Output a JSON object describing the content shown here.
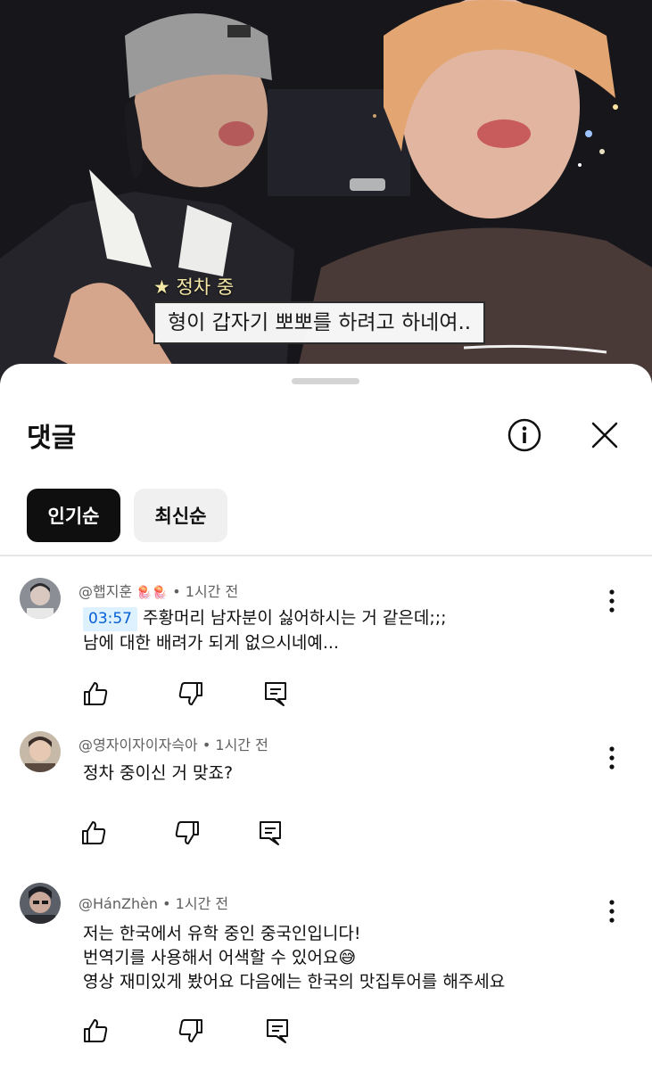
{
  "video": {
    "caption_label": "★ 정차 중",
    "caption_text": "형이 갑자기 뽀뽀를 하려고 하네여.."
  },
  "sheet": {
    "title": "댓글",
    "info_icon": "info-circle-icon",
    "close_icon": "close-icon",
    "sort_chips": [
      {
        "label": "인기순",
        "selected": true
      },
      {
        "label": "최신순",
        "selected": false
      }
    ]
  },
  "comments": [
    {
      "author": "@햅지훈",
      "author_emoji": "🪼🪼",
      "time": "• 1시간 전",
      "timestamp_link": "03:57",
      "lines": [
        "주황머리 남자분이 싫어하시는 거 같은데;;;",
        "남에 대한 배려가 되게 없으시네예..."
      ]
    },
    {
      "author": "@영자이자이자슥아",
      "time": "• 1시간 전",
      "lines": [
        "정차 중이신 거 맞죠?"
      ]
    },
    {
      "author": "@HánZhèn",
      "time": "• 1시간 전",
      "lines": [
        "저는 한국에서 유학 중인 중국인입니다!",
        "번역기를 사용해서 어색할 수 있어요😅",
        "영상 재미있게 봤어요 다음에는 한국의 맛집투어를 해주세요"
      ]
    }
  ],
  "colors": {
    "accent_link": "#065fd4",
    "timestamp_bg": "#def1ff",
    "chip_active": "#0f0f0f",
    "chip_inactive": "#f0f0f0",
    "caption_label": "#f6e9a6"
  }
}
